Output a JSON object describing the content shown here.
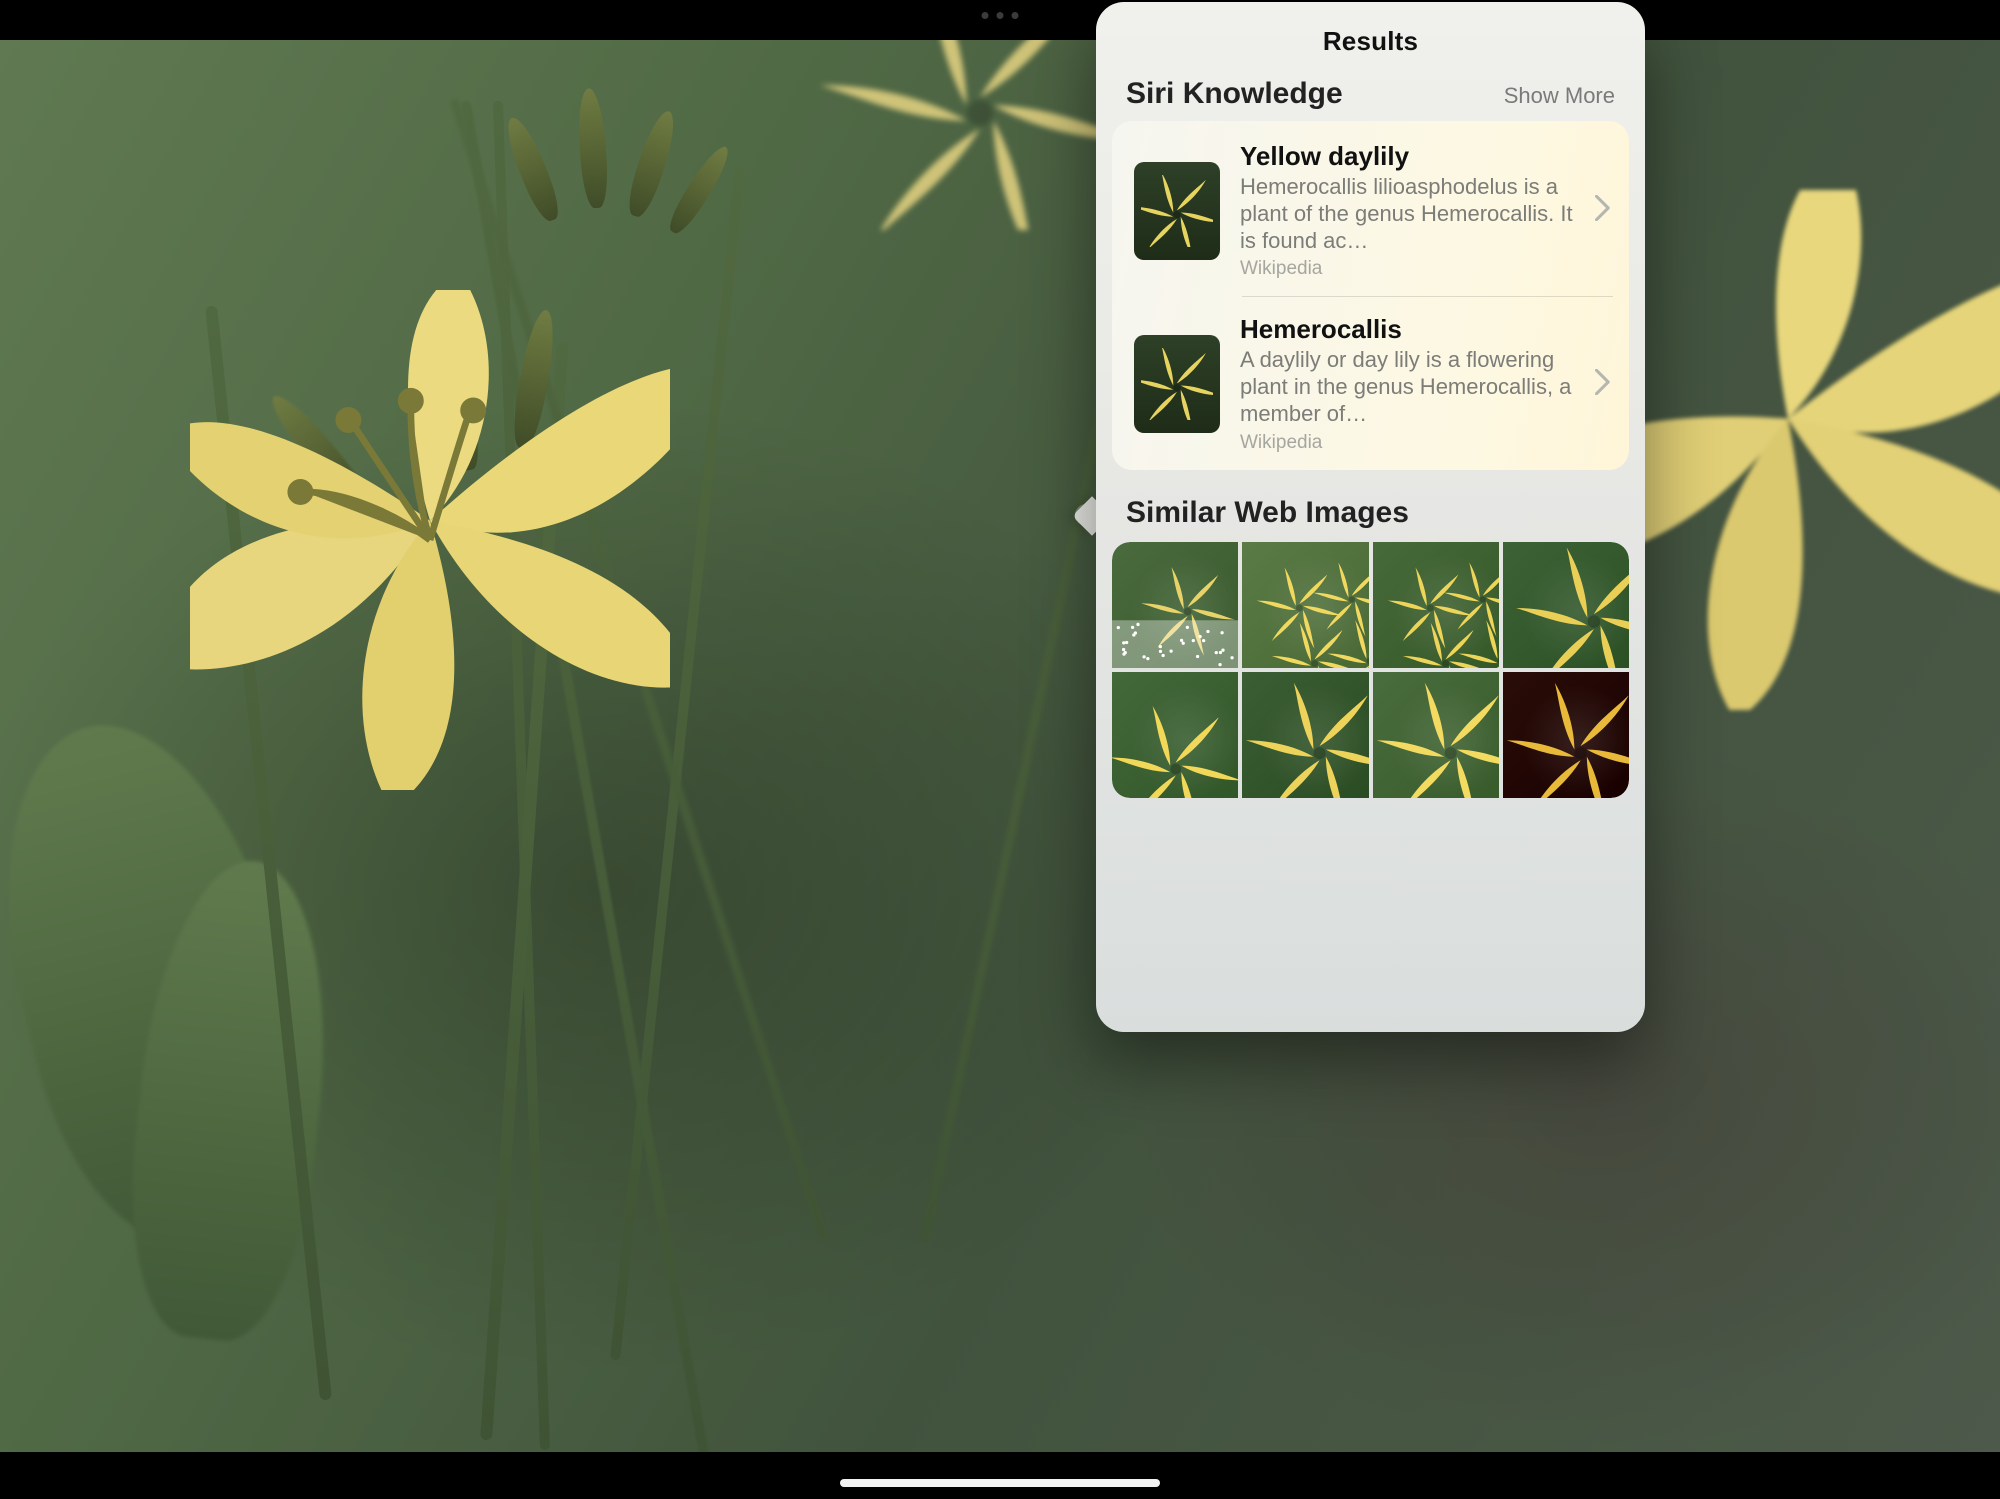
{
  "panel": {
    "header": "Results",
    "siri": {
      "title": "Siri Knowledge",
      "show_more": "Show More",
      "items": [
        {
          "title": "Yellow daylily",
          "desc": "Hemerocallis lilioasphodelus is a plant of the genus Hemerocallis. It is found ac…",
          "source": "Wikipedia",
          "thumb_icon": "flower-icon"
        },
        {
          "title": "Hemerocallis",
          "desc": "A daylily or day lily is a flowering plant in the genus Hemerocallis, a member of…",
          "source": "Wikipedia",
          "thumb_icon": "flower-icon"
        }
      ]
    },
    "similar": {
      "title": "Similar Web Images",
      "images": [
        {
          "bg": "#4a6b3e",
          "accent": "#e8d36a",
          "variant": "one-small"
        },
        {
          "bg": "#5a7a46",
          "accent": "#f0d95e",
          "variant": "multi"
        },
        {
          "bg": "#476a3a",
          "accent": "#edd55a",
          "variant": "multi"
        },
        {
          "bg": "#3d6236",
          "accent": "#e9cf55",
          "variant": "one-large"
        },
        {
          "bg": "#43683a",
          "accent": "#f1d858",
          "variant": "side"
        },
        {
          "bg": "#3c5e34",
          "accent": "#edd35a",
          "variant": "center"
        },
        {
          "bg": "#4a6d3d",
          "accent": "#f2db60",
          "variant": "center"
        },
        {
          "bg": "#2a0d08",
          "accent": "#e9b93a",
          "variant": "center"
        }
      ]
    }
  }
}
